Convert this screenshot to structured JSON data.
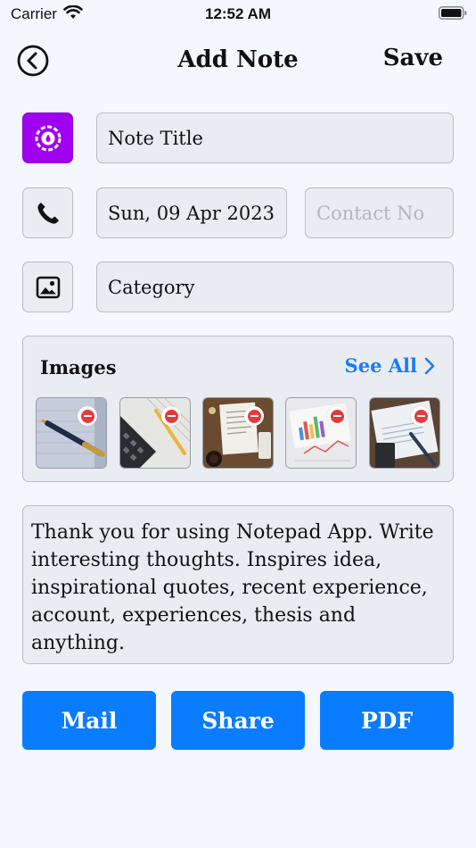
{
  "status_bar": {
    "carrier": "Carrier",
    "time": "12:52 AM"
  },
  "nav": {
    "title": "Add Note",
    "save_label": "Save"
  },
  "form": {
    "note_title": "Note Title",
    "date": "Sun, 09 Apr 2023",
    "contact_placeholder": "Contact No",
    "category": "Category"
  },
  "images": {
    "label": "Images",
    "see_all_label": "See All",
    "thumbnails": [
      {
        "subject": "pen on notebook"
      },
      {
        "subject": "calculator and pencil"
      },
      {
        "subject": "documents with coffee"
      },
      {
        "subject": "charts on paper"
      },
      {
        "subject": "invoice and calculator"
      }
    ]
  },
  "note_text": "Thank you for using Notepad App. Write interesting thoughts. Inspires idea, inspirational quotes, recent experience, account, experiences, thesis and anything.",
  "actions": {
    "mail_label": "Mail",
    "share_label": "Share",
    "pdf_label": "PDF"
  },
  "colors": {
    "accent": "#0a7cff",
    "color_button": "#a000f0",
    "link": "#1a7df5",
    "remove": "#e5393c"
  },
  "icons": [
    "wifi-icon",
    "battery-icon",
    "back-chevron-icon",
    "color-palette-icon",
    "phone-icon",
    "image-icon",
    "chevron-right-icon",
    "remove-icon"
  ]
}
